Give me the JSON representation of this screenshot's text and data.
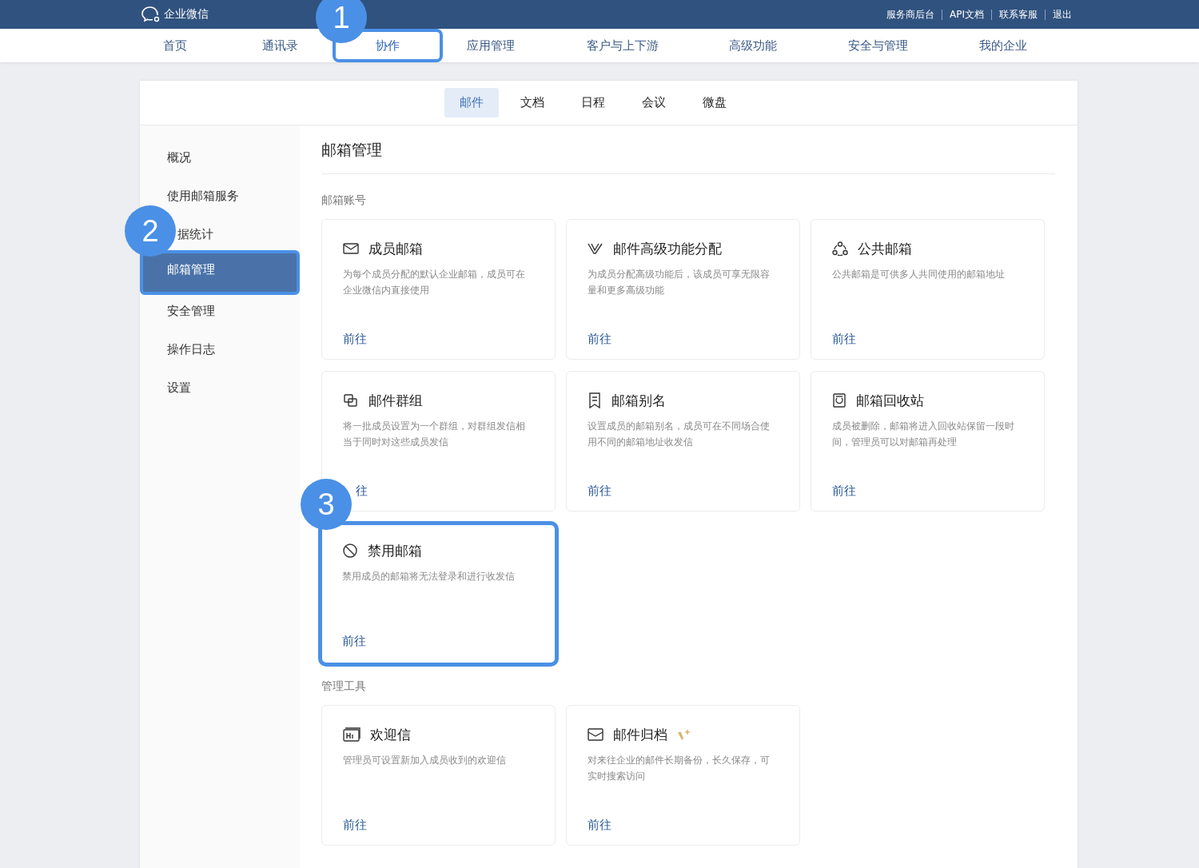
{
  "topbar": {
    "logo": "企业微信",
    "links": [
      "服务商后台",
      "API文档",
      "联系客服",
      "退出"
    ]
  },
  "nav": [
    {
      "label": "首页",
      "selected": false,
      "highlighted": false
    },
    {
      "label": "通讯录",
      "selected": false,
      "highlighted": false
    },
    {
      "label": "协作",
      "selected": true,
      "highlighted": true
    },
    {
      "label": "应用管理",
      "selected": false,
      "highlighted": false
    },
    {
      "label": "客户与上下游",
      "selected": false,
      "highlighted": false
    },
    {
      "label": "高级功能",
      "selected": false,
      "highlighted": false
    },
    {
      "label": "安全与管理",
      "selected": false,
      "highlighted": false
    },
    {
      "label": "我的企业",
      "selected": false,
      "highlighted": false
    }
  ],
  "subtabs": [
    {
      "label": "邮件",
      "selected": true
    },
    {
      "label": "文档",
      "selected": false
    },
    {
      "label": "日程",
      "selected": false
    },
    {
      "label": "会议",
      "selected": false
    },
    {
      "label": "微盘",
      "selected": false
    }
  ],
  "sidebar": {
    "items": [
      {
        "label": "概况",
        "selected": false,
        "highlighted": false
      },
      {
        "label": "使用邮箱服务",
        "selected": false,
        "highlighted": false
      },
      {
        "label": "据统计",
        "selected": false,
        "highlighted": false
      },
      {
        "label": "邮箱管理",
        "selected": true,
        "highlighted": true
      },
      {
        "label": "安全管理",
        "selected": false,
        "highlighted": false
      },
      {
        "label": "操作日志",
        "selected": false,
        "highlighted": false
      },
      {
        "label": "设置",
        "selected": false,
        "highlighted": false
      }
    ]
  },
  "page_title": "邮箱管理",
  "sections": [
    {
      "title": "邮箱账号",
      "cards": [
        {
          "title": "成员邮箱",
          "description": "为每个成员分配的默认企业邮箱，成员可在企业微信内直接使用",
          "link": "前往",
          "highlighted": false,
          "premium": false
        },
        {
          "title": "邮件高级功能分配",
          "description": "为成员分配高级功能后，该成员可享无限容量和更多高级功能",
          "link": "前往",
          "highlighted": false,
          "premium": false
        },
        {
          "title": "公共邮箱",
          "description": "公共邮箱是可供多人共同使用的邮箱地址",
          "link": "前往",
          "highlighted": false,
          "premium": false
        },
        {
          "title": "邮件群组",
          "description": "将一批成员设置为一个群组，对群组发信相当于同时对这些成员发信",
          "link": "往",
          "highlighted": false,
          "premium": false
        },
        {
          "title": "邮箱别名",
          "description": "设置成员的邮箱别名，成员可在不同场合使用不同的邮箱地址收发信",
          "link": "前往",
          "highlighted": false,
          "premium": false
        },
        {
          "title": "邮箱回收站",
          "description": "成员被删除，邮箱将进入回收站保留一段时间，管理员可以对邮箱再处理",
          "link": "前往",
          "highlighted": false,
          "premium": false
        },
        {
          "title": "禁用邮箱",
          "description": "禁用成员的邮箱将无法登录和进行收发信",
          "link": "前往",
          "highlighted": true,
          "premium": false
        }
      ]
    },
    {
      "title": "管理工具",
      "cards": [
        {
          "title": "欢迎信",
          "description": "管理员可设置新加入成员收到的欢迎信",
          "link": "前往",
          "highlighted": false,
          "premium": false
        },
        {
          "title": "邮件归档",
          "description": "对来往企业的邮件长期备份，长久保存，可实时搜索访问",
          "link": "前往",
          "highlighted": false,
          "premium": true
        }
      ]
    }
  ],
  "callouts": [
    "1",
    "2",
    "3"
  ]
}
